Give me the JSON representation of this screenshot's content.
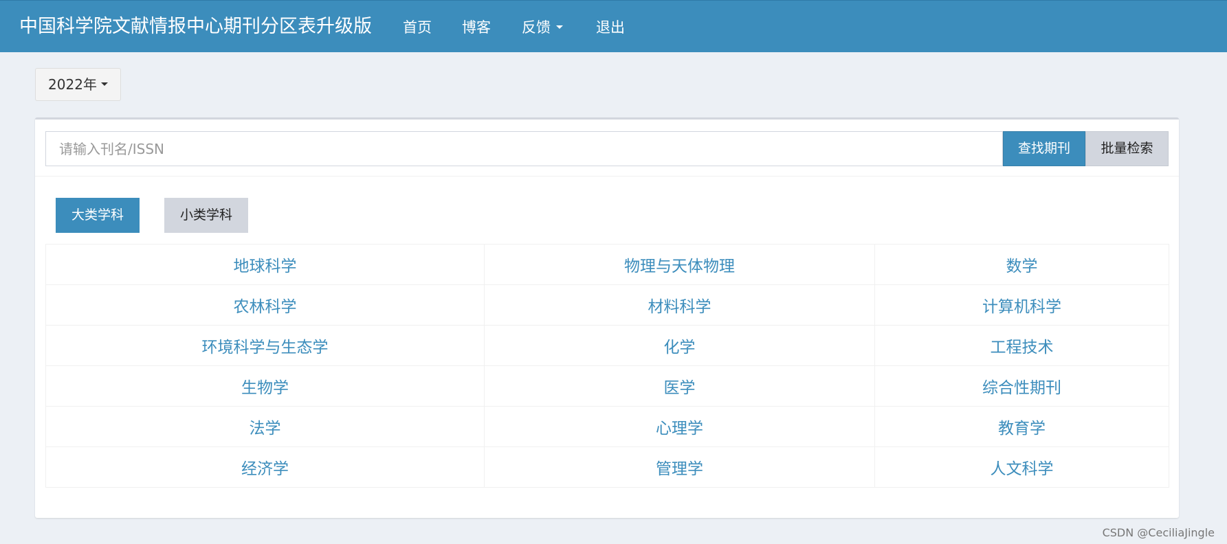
{
  "header": {
    "brand": "中国科学院文献情报中心期刊分区表升级版",
    "nav": {
      "home": "首页",
      "blog": "博客",
      "feedback": "反馈",
      "logout": "退出"
    }
  },
  "year_select": {
    "selected": "2022年"
  },
  "search": {
    "placeholder": "请输入刊名/ISSN",
    "value": "",
    "find_label": "查找期刊",
    "batch_label": "批量检索"
  },
  "tabs": {
    "major": "大类学科",
    "minor": "小类学科",
    "active": "major"
  },
  "subjects": [
    [
      "地球科学",
      "物理与天体物理",
      "数学"
    ],
    [
      "农林科学",
      "材料科学",
      "计算机科学"
    ],
    [
      "环境科学与生态学",
      "化学",
      "工程技术"
    ],
    [
      "生物学",
      "医学",
      "综合性期刊"
    ],
    [
      "法学",
      "心理学",
      "教育学"
    ],
    [
      "经济学",
      "管理学",
      "人文科学"
    ]
  ],
  "watermark": "CSDN @CeciliaJingle",
  "colors": {
    "primary": "#3c8dbc",
    "background": "#ecf0f5",
    "secondary_button": "#d2d6de"
  }
}
